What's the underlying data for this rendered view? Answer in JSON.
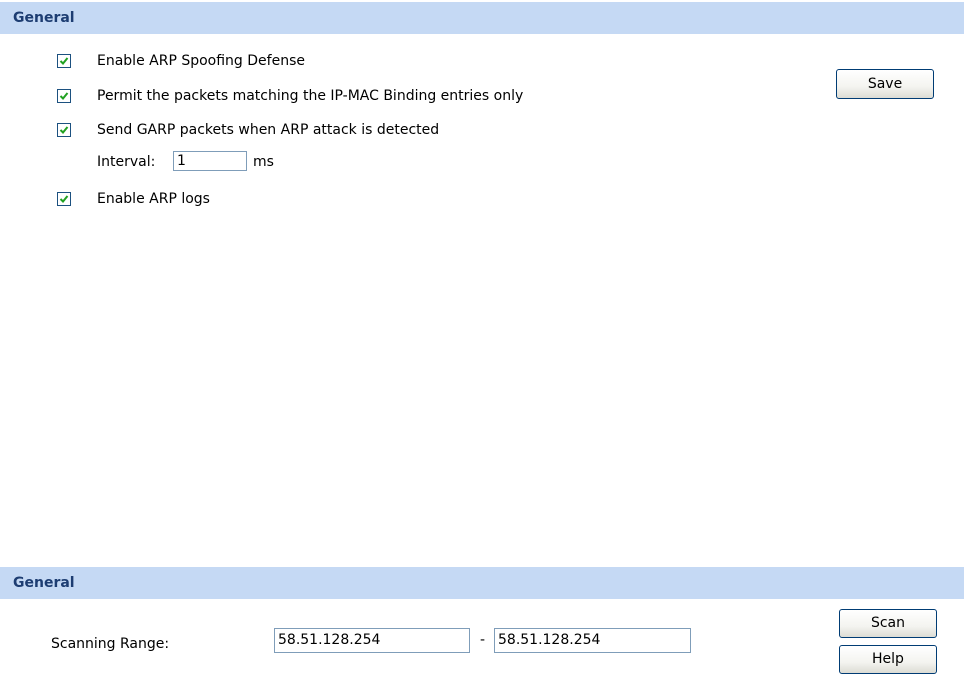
{
  "arp_section": {
    "title": "General",
    "options": [
      {
        "label": "Enable ARP Spoofing Defense",
        "checked": true
      },
      {
        "label": "Permit the packets matching the IP-MAC Binding entries only",
        "checked": true
      },
      {
        "label": "Send GARP packets when ARP attack is detected",
        "checked": true
      },
      {
        "label": "Enable ARP logs",
        "checked": true
      }
    ],
    "interval_label": "Interval:",
    "interval_value": "1",
    "interval_unit": "ms",
    "save_label": "Save"
  },
  "scan_section": {
    "title": "General",
    "range_label": "Scanning Range:",
    "range_start": "58.51.128.254",
    "range_separator": "-",
    "range_end": "58.51.128.254",
    "scan_label": "Scan",
    "help_label": "Help"
  },
  "colors": {
    "header_bg": "#c5d9f4",
    "header_text": "#1d3d72",
    "check_mark": "#21a121"
  },
  "icons": {
    "checkbox": "check-icon"
  }
}
